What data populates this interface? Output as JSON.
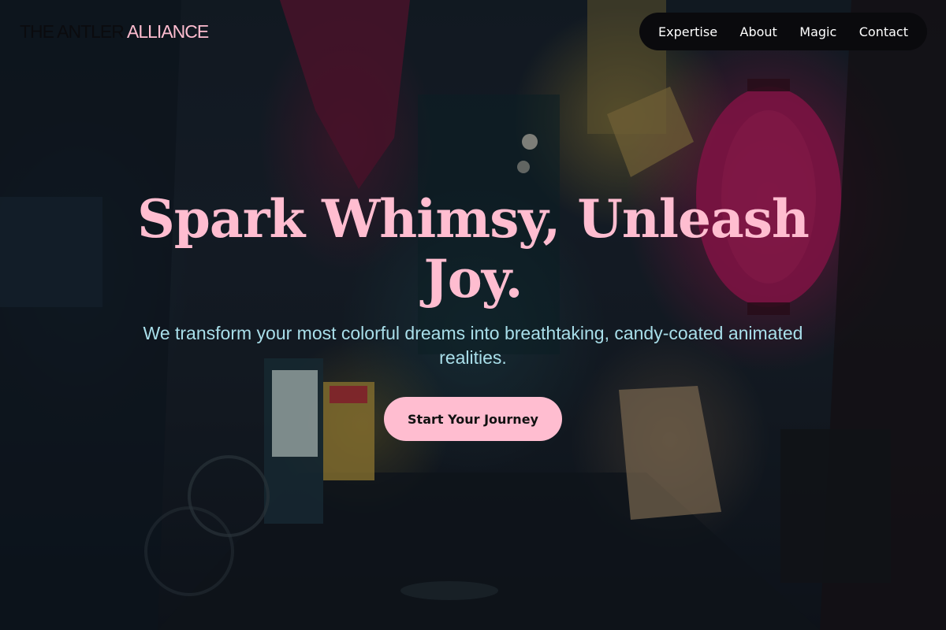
{
  "brand": {
    "dark_text": "THE ANTLER",
    "accent_text": "ALLIANCE"
  },
  "nav": {
    "items": [
      {
        "label": "Expertise"
      },
      {
        "label": "About"
      },
      {
        "label": "Magic"
      },
      {
        "label": "Contact"
      }
    ]
  },
  "hero": {
    "title": "Spark Whimsy, Unleash Joy.",
    "subtitle": "We transform your most colorful dreams into breathtaking, candy-coated animated realities.",
    "cta_label": "Start Your Journey"
  },
  "colors": {
    "accent_pink": "#ffbdd0",
    "subtitle_cyan": "#a9dfea",
    "nav_background": "#0a0a0d",
    "brand_dark": "#0b0b0e"
  }
}
